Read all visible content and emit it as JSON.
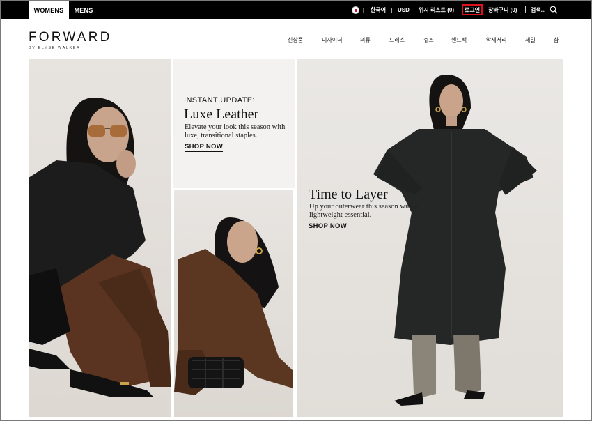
{
  "topbar": {
    "tabs": {
      "womens": "WOMENS",
      "mens": "MENS"
    },
    "language": "한국어",
    "currency": "USD",
    "wishlist": "위시 리스트 (0)",
    "login": "로그인",
    "cart": "장바구니 (0)",
    "search": "검색...",
    "divider": "|"
  },
  "header": {
    "logo": "FORWARD",
    "logo_sub": "BY ELYSE WALKER",
    "nav": [
      "신상품",
      "디자이너",
      "의류",
      "드레스",
      "슈즈",
      "핸드백",
      "악세서리",
      "세일",
      "샵"
    ]
  },
  "hero": {
    "luxe": {
      "kicker": "INSTANT UPDATE:",
      "title": "Luxe Leather",
      "desc": "Elevate your look this season with luxe, transitional staples.",
      "cta": "SHOP NOW"
    },
    "layer": {
      "title": "Time to Layer",
      "desc": "Up your outerwear this season with a lightweight essential.",
      "cta": "SHOP NOW"
    }
  },
  "colors": {
    "topbar": "#000000",
    "login_highlight": "#e0101f"
  }
}
